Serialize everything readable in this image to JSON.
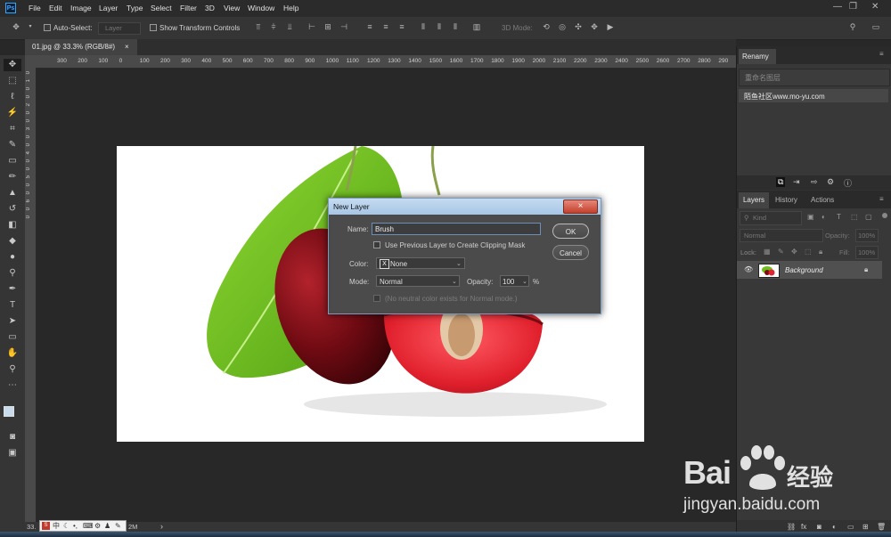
{
  "app": {
    "logo_text": "Ps"
  },
  "menu": [
    "File",
    "Edit",
    "Image",
    "Layer",
    "Type",
    "Select",
    "Filter",
    "3D",
    "View",
    "Window",
    "Help"
  ],
  "options": {
    "auto_select_label": "Auto-Select:",
    "auto_select_value": "Layer",
    "show_transform_label": "Show Transform Controls",
    "mode_3d_label": "3D Mode:"
  },
  "document": {
    "tab_title": "01.jpg @ 33.3% (RGB/8#)",
    "tab_close": "×",
    "zoom": "33"
  },
  "ruler_top": [
    "300",
    "200",
    "100",
    "0",
    "100",
    "200",
    "300",
    "400",
    "500",
    "600",
    "700",
    "800",
    "900",
    "1000",
    "1100",
    "1200",
    "1300",
    "1400",
    "1500",
    "1600",
    "1700",
    "1800",
    "1900",
    "2000",
    "2100",
    "2200",
    "2300",
    "2400",
    "2500",
    "2600",
    "2700",
    "2800",
    "290"
  ],
  "ruler_left": [
    "0",
    "1",
    "0",
    "0",
    "2",
    "0",
    "0",
    "3",
    "0",
    "0",
    "4",
    "0",
    "0",
    "5",
    "0",
    "0",
    "6",
    "0",
    "0"
  ],
  "renamy_panel": {
    "title": "Renamy",
    "input_placeholder": "重命名图层",
    "item": "陌鱼社区www.mo-yu.com"
  },
  "layers_panel": {
    "tabs": [
      "Layers",
      "History",
      "Actions"
    ],
    "kind_label": "Kind",
    "blend_mode": "Normal",
    "opacity_label": "Opacity:",
    "opacity_value": "100%",
    "lock_label": "Lock:",
    "fill_label": "Fill:",
    "fill_value": "100%",
    "layer_name": "Background"
  },
  "dialog": {
    "title": "New Layer",
    "close": "×",
    "name_label": "Name:",
    "name_value": "Brush",
    "clipping_label": "Use Previous Layer to Create Clipping Mask",
    "color_label": "Color:",
    "color_value": "None",
    "color_swatch": "X",
    "mode_label": "Mode:",
    "mode_value": "Normal",
    "opacity_label": "Opacity:",
    "opacity_value": "100",
    "percent": "%",
    "neutral_label": "(No neutral color exists for Normal mode.)",
    "ok_label": "OK",
    "cancel_label": "Cancel"
  },
  "status": {
    "zoom": "33.",
    "size": "2M",
    "arrow": "›"
  },
  "ime": {
    "mode": "中"
  },
  "watermark": {
    "brand": "Bai",
    "brand_suffix": "经验",
    "url": "jingyan.baidu.com"
  },
  "colors": {
    "accent": "#31a8ff",
    "dialog_title": "#b5d0ec",
    "leaf": "#6cbf1c",
    "cherry": "#7a0d14",
    "cherry_half": "#e02530"
  }
}
